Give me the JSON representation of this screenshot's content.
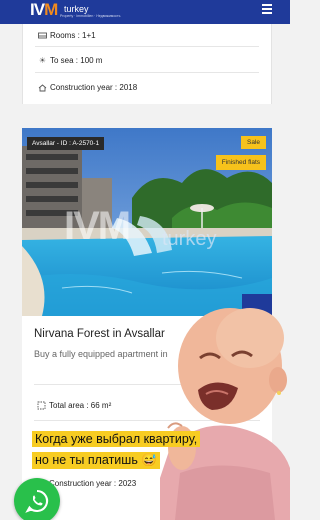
{
  "header": {
    "logo_mark_1": "IV",
    "logo_mark_2": "M",
    "logo_word": "turkey",
    "logo_tagline": "Property · Immobilien · Недвижимость"
  },
  "listing_top": {
    "rooms": "Rooms : 1+1",
    "to_sea": "To sea : 100 m",
    "construction_year": "Construction year : 2018"
  },
  "listing": {
    "id_tag": "Avsallar - ID : A-2570-1",
    "badge_sale": "Sale",
    "badge_finished": "Finished flats",
    "watermark": "IVM",
    "watermark_word": "turkey",
    "title": "Nirvana Forest in Avsallar",
    "subtitle": "Buy a fully equipped apartment in",
    "total_area": "Total area : 66 m²",
    "construction_year": "Construction year : 2023"
  },
  "meme": {
    "line1": "Когда уже выбрал квартиру,",
    "line2": "но не ты платишь 😅"
  },
  "whatsapp": {
    "icon": "whatsapp-icon"
  },
  "colors": {
    "header": "#1f3a9a",
    "badge": "#f7c21b",
    "brand_orange": "#f28a1e",
    "whatsapp": "#29c04b",
    "meme_highlight": "#f7cc22"
  }
}
